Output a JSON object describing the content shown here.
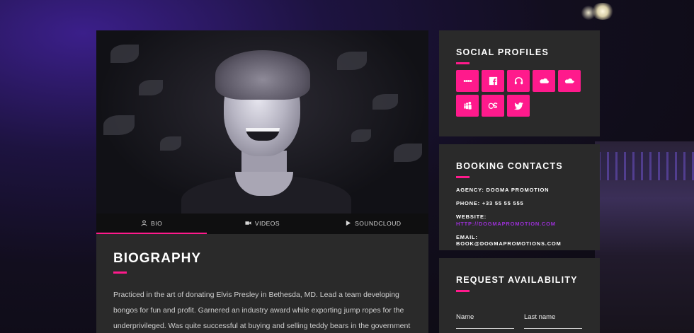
{
  "colors": {
    "accent": "#ff1a8c",
    "link": "#9b2fd6",
    "card": "#2a2a2a"
  },
  "tabs": [
    {
      "label": "BIO",
      "icon": "user-icon",
      "active": true
    },
    {
      "label": "VIDEOS",
      "icon": "video-camera-icon",
      "active": false
    },
    {
      "label": "SOUNDCLOUD",
      "icon": "play-icon",
      "active": false
    }
  ],
  "biography": {
    "title": "BIOGRAPHY",
    "text": "Practiced in the art of donating Elvis Presley in Bethesda, MD. Lead a team developing bongos for fun and profit. Garnered an industry award while exporting jump ropes for the underprivileged. Was quite successful at buying and selling teddy bears in the government"
  },
  "social": {
    "title": "SOCIAL PROFILES",
    "icons": [
      "bandcamp-icon",
      "facebook-icon",
      "headphones-icon",
      "soundcloud-icon",
      "mixcloud-icon",
      "myspace-icon",
      "lastfm-icon",
      "twitter-icon"
    ]
  },
  "booking": {
    "title": "BOOKING CONTACTS",
    "agency": "AGENCY: DOGMA PROMOTION",
    "phone": "PHONE: +33 55 55 555",
    "website_label": "WEBSITE:",
    "website_url": "HTTP://DOGMAPROMOTION.COM",
    "email": "EMAIL: BOOK@DOGMAPROMOTIONS.COM"
  },
  "request": {
    "title": "REQUEST AVAILABILITY",
    "name_label": "Name",
    "lastname_label": "Last name"
  }
}
